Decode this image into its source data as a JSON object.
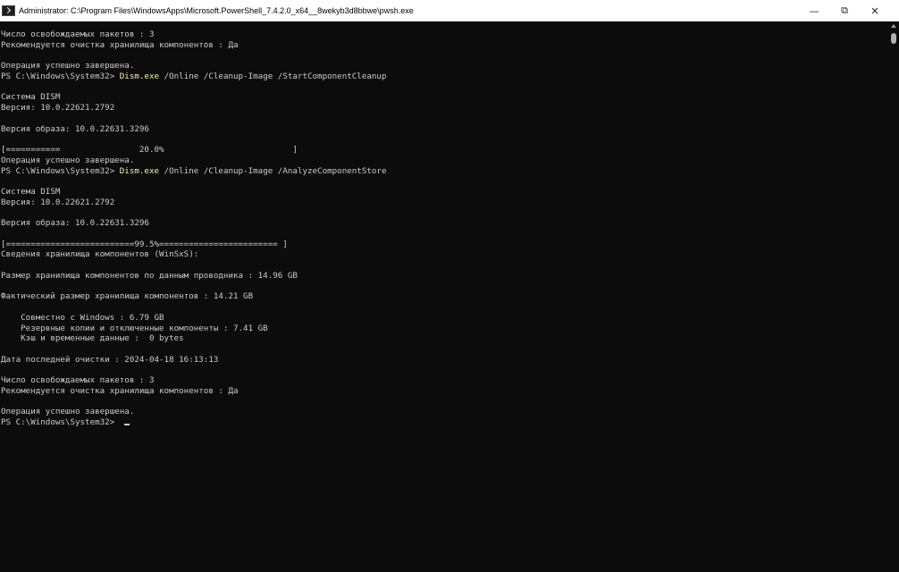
{
  "window": {
    "title": "Administrator: C:\\Program Files\\WindowsApps\\Microsoft.PowerShell_7.4.2.0_x64__8wekyb3d8bbwe\\pwsh.exe",
    "icon": "powershell-icon",
    "minimize_icon": "—",
    "maximize_icon": "⧉",
    "close_icon": "✕"
  },
  "colors": {
    "background": "#0c0c0c",
    "text": "#cccccc",
    "command": "#f9f1a5"
  },
  "terminal": {
    "lines": [
      {
        "text": "Число освобождаемых пакетов : 3"
      },
      {
        "text": "Рекомендуется очистка хранилища компонентов : Да"
      },
      {
        "text": ""
      },
      {
        "text": "Операция успешно завершена."
      },
      {
        "prompt": "PS C:\\Windows\\System32> ",
        "command": "Dism.exe",
        "args": " /Online /Cleanup-Image /StartComponentCleanup"
      },
      {
        "text": ""
      },
      {
        "text": "Система DISM"
      },
      {
        "text": "Версия: 10.0.22621.2792"
      },
      {
        "text": ""
      },
      {
        "text": "Версия образа: 10.0.22631.3296"
      },
      {
        "text": ""
      },
      {
        "text": "[===========                20.0%                          ]"
      },
      {
        "text": "Операция успешно завершена."
      },
      {
        "prompt": "PS C:\\Windows\\System32> ",
        "command": "Dism.exe",
        "args": " /Online /Cleanup-Image /AnalyzeComponentStore"
      },
      {
        "text": ""
      },
      {
        "text": "Система DISM"
      },
      {
        "text": "Версия: 10.0.22621.2792"
      },
      {
        "text": ""
      },
      {
        "text": "Версия образа: 10.0.22631.3296"
      },
      {
        "text": ""
      },
      {
        "text": "[==========================99.5%======================== ]"
      },
      {
        "text": "Сведения хранилища компонентов (WinSxS):"
      },
      {
        "text": ""
      },
      {
        "text": "Размер хранилища компонентов по данным проводника : 14.96 GB"
      },
      {
        "text": ""
      },
      {
        "text": "Фактический размер хранилища компонентов : 14.21 GB"
      },
      {
        "text": ""
      },
      {
        "text": "    Совместно с Windows : 6.79 GB"
      },
      {
        "text": "    Резервные копии и отключенные компоненты : 7.41 GB"
      },
      {
        "text": "    Кэш и временные данные :  0 bytes"
      },
      {
        "text": ""
      },
      {
        "text": "Дата последней очистки : 2024-04-18 16:13:13"
      },
      {
        "text": ""
      },
      {
        "text": "Число освобождаемых пакетов : 3"
      },
      {
        "text": "Рекомендуется очистка хранилища компонентов : Да"
      },
      {
        "text": ""
      },
      {
        "text": "Операция успешно завершена."
      },
      {
        "prompt": "PS C:\\Windows\\System32> ",
        "cursor": true
      }
    ]
  }
}
